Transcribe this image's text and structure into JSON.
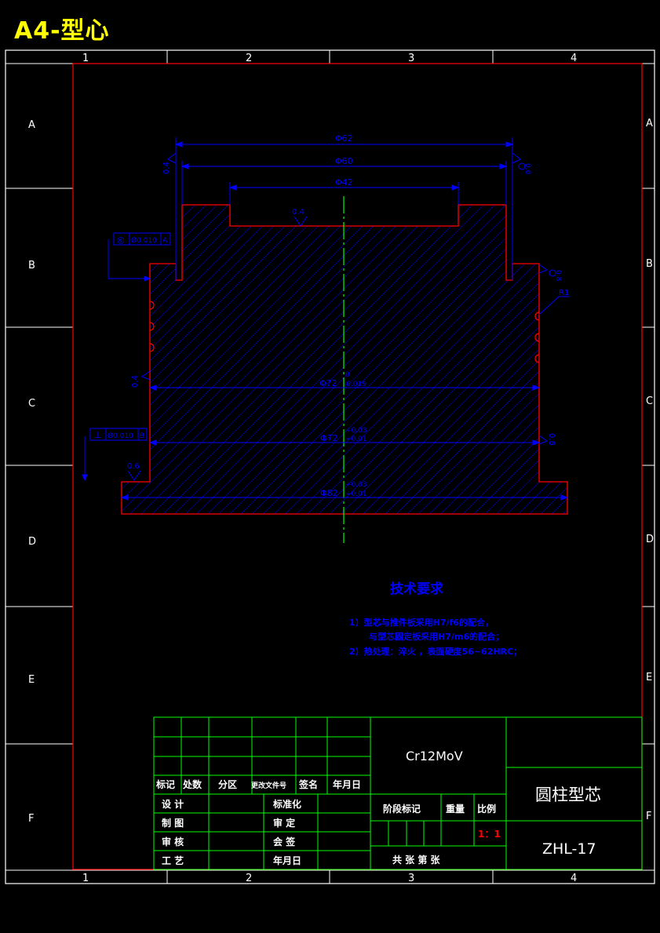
{
  "sheet_title": "A4-型心",
  "grid": {
    "columns": [
      "1",
      "2",
      "3",
      "4"
    ],
    "rows": [
      "A",
      "B",
      "C",
      "D",
      "E",
      "F"
    ]
  },
  "drawing": {
    "dims": {
      "d62": "Φ62",
      "d60": "Φ60",
      "d42": "Φ42",
      "d72a_main": "Φ72",
      "d72a_tol_top": "0",
      "d72a_tol_bot": "-0.019",
      "d72b_main": "Φ72",
      "d72b_tol_top": "+0.03",
      "d72b_tol_bot": "+0.01",
      "d82_main": "Φ82",
      "d82_tol_top": "+0.03",
      "d82_tol_bot": "+0.01"
    },
    "roughness": {
      "top_left": "0.4",
      "top_right": "0.8",
      "recess": "0.4",
      "right_mid": "0.8",
      "left_mid": "0.4",
      "right_low": "0.8",
      "bottom_left": "0.6"
    },
    "radius": "R1",
    "datum_label": "A",
    "gtol_top": {
      "symbol": "◎",
      "value": "Ø0.010",
      "datum": "A"
    },
    "gtol_bottom": {
      "symbol": "⊥",
      "value": "Ø0.010",
      "datum": "B"
    }
  },
  "tech": {
    "heading": "技术要求",
    "lines": [
      "1）型芯与推件板采用H7/f6的配合，",
      "与型芯固定板采用H7/m6的配合；",
      "2）热处理：淬火 ，表面硬度56~62HRC；"
    ]
  },
  "title_block": {
    "rev_headers": [
      "标记",
      "处数",
      "分区",
      "更改文件号",
      "签名",
      "年月日"
    ],
    "sign_rows": [
      [
        "设  计",
        "标准化"
      ],
      [
        "制  图",
        "审  定"
      ],
      [
        "审  核",
        "会  签"
      ],
      [
        "工  艺",
        "年月日"
      ]
    ],
    "material": "Cr12MoV",
    "stage_headers": [
      "阶段标记",
      "重量",
      "比例"
    ],
    "scale": "1：1",
    "sheet_count": "共  张  第  张",
    "part_name": "圆柱型芯",
    "drawing_no": "ZHL-17"
  },
  "colors": {
    "frame": "#ffffff",
    "inner_border": "#ff0000",
    "dimension": "#0000ff",
    "part_outline": "#ff0000",
    "centerline": "#00ff00",
    "title_text": "#ffff00",
    "table_lines": "#00ff00"
  }
}
